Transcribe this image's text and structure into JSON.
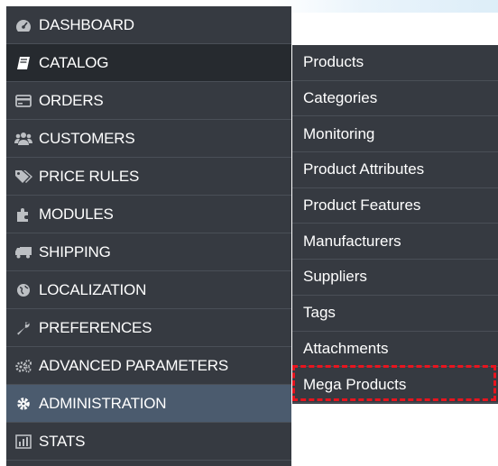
{
  "sidebar": {
    "items": [
      {
        "label": "DASHBOARD",
        "icon": "dashboard-gauge-icon"
      },
      {
        "label": "CATALOG",
        "icon": "book-icon"
      },
      {
        "label": "ORDERS",
        "icon": "credit-card-icon"
      },
      {
        "label": "CUSTOMERS",
        "icon": "users-icon"
      },
      {
        "label": "PRICE RULES",
        "icon": "tags-icon"
      },
      {
        "label": "MODULES",
        "icon": "puzzle-icon"
      },
      {
        "label": "SHIPPING",
        "icon": "truck-icon"
      },
      {
        "label": "LOCALIZATION",
        "icon": "globe-icon"
      },
      {
        "label": "PREFERENCES",
        "icon": "wrench-icon"
      },
      {
        "label": "ADVANCED PARAMETERS",
        "icon": "cogs-icon"
      },
      {
        "label": "ADMINISTRATION",
        "icon": "cog-icon"
      },
      {
        "label": "STATS",
        "icon": "bar-chart-icon"
      }
    ]
  },
  "submenu": {
    "items": [
      {
        "label": "Products"
      },
      {
        "label": "Categories"
      },
      {
        "label": "Monitoring"
      },
      {
        "label": "Product Attributes"
      },
      {
        "label": "Product Features"
      },
      {
        "label": "Manufacturers"
      },
      {
        "label": "Suppliers"
      },
      {
        "label": "Tags"
      },
      {
        "label": "Attachments"
      },
      {
        "label": "Mega Products"
      }
    ]
  },
  "colors": {
    "sidebar_bg": "#363a41",
    "active_bg": "#262a2f",
    "selected_bg": "#4b5b6e",
    "highlight": "#e8141e"
  }
}
